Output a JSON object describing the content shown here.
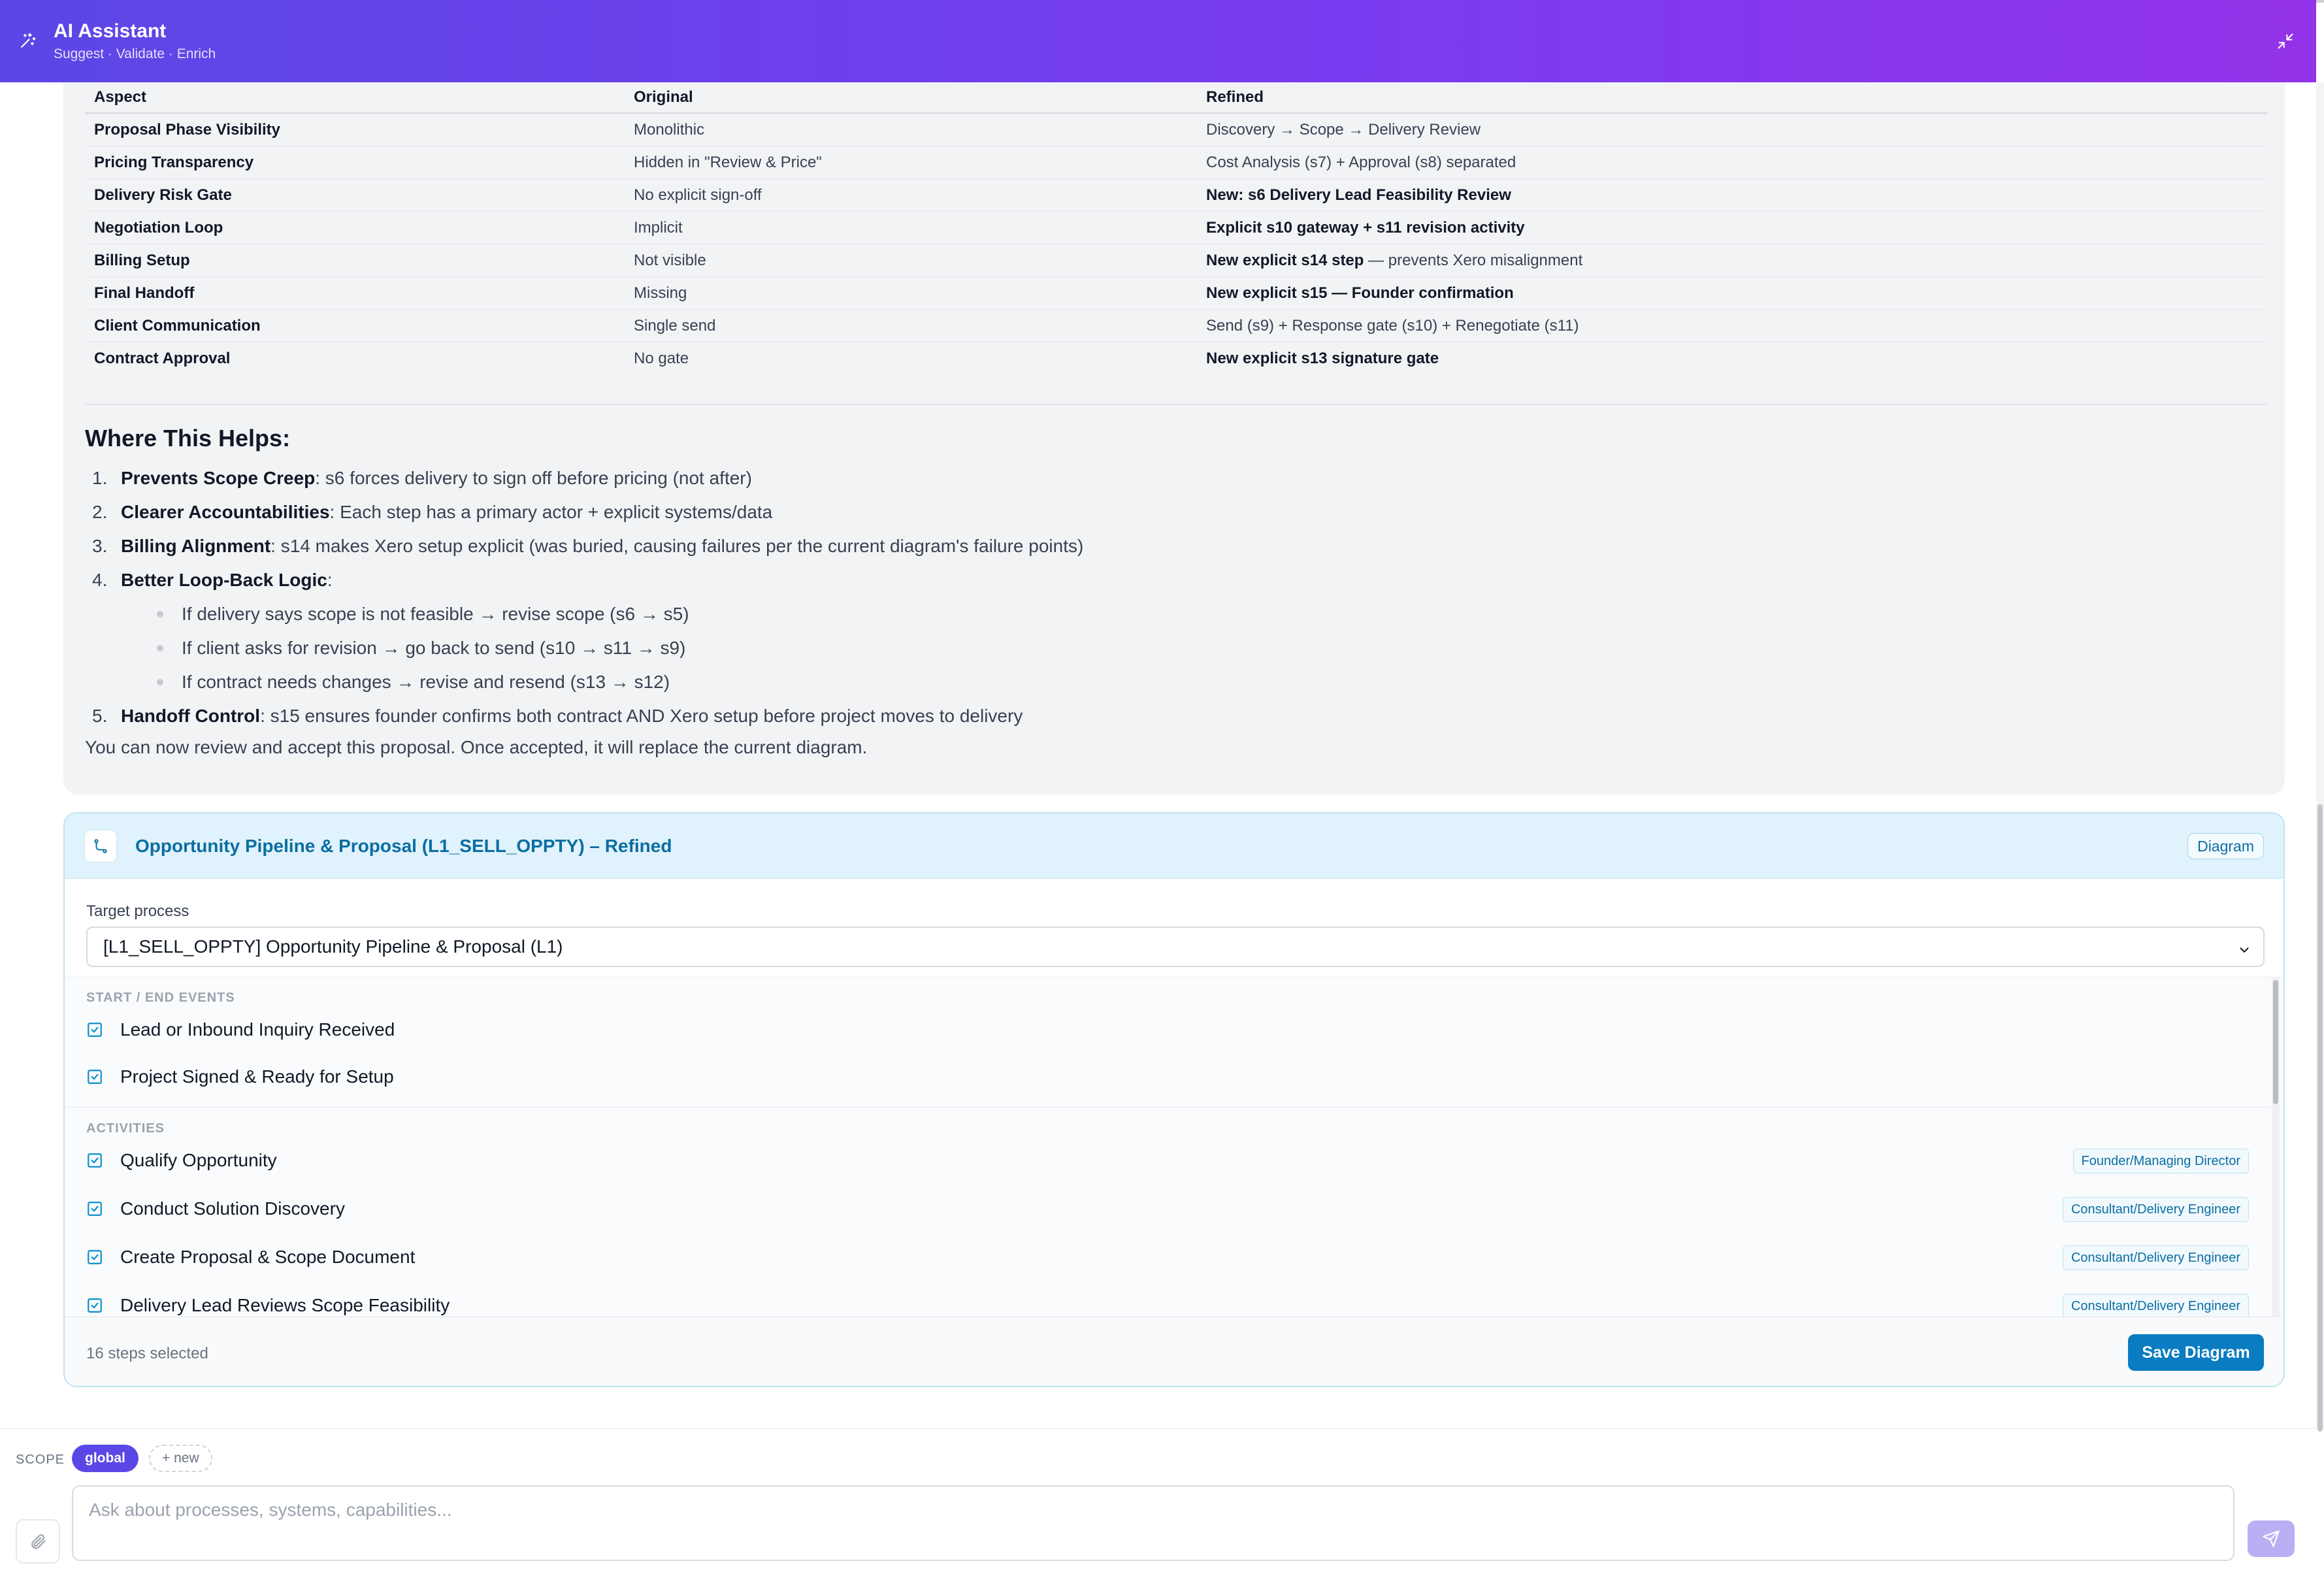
{
  "header": {
    "title": "AI Assistant",
    "subtitle": "Suggest · Validate · Enrich",
    "collapse_icon": "collapse-icon",
    "logo_icon": "sparkles-icon",
    "gradient": [
      "#5b47e6",
      "#9333ea"
    ]
  },
  "comparison": {
    "headers": [
      "Aspect",
      "Original",
      "Refined"
    ],
    "rows": [
      {
        "aspect": "Proposal Phase Visibility",
        "original": "Monolithic",
        "refined_bold": "",
        "refined": "Discovery → Scope → Delivery Review"
      },
      {
        "aspect": "Pricing Transparency",
        "original": "Hidden in \"Review & Price\"",
        "refined_bold": "",
        "refined": "Cost Analysis (s7) + Approval (s8) separated"
      },
      {
        "aspect": "Delivery Risk Gate",
        "original": "No explicit sign-off",
        "refined_bold": "New: s6 Delivery Lead Feasibility Review",
        "refined": ""
      },
      {
        "aspect": "Negotiation Loop",
        "original": "Implicit",
        "refined_bold": "Explicit s10 gateway + s11 revision activity",
        "refined": ""
      },
      {
        "aspect": "Billing Setup",
        "original": "Not visible",
        "refined_bold": "New explicit s14 step",
        "refined": " — prevents Xero misalignment"
      },
      {
        "aspect": "Final Handoff",
        "original": "Missing",
        "refined_bold": "New explicit s15 — Founder confirmation",
        "refined": ""
      },
      {
        "aspect": "Client Communication",
        "original": "Single send",
        "refined_bold": "",
        "refined": "Send (s9) + Response gate (s10) + Renegotiate (s11)"
      },
      {
        "aspect": "Contract Approval",
        "original": "No gate",
        "refined_bold": "New explicit s13 signature gate",
        "refined": ""
      }
    ]
  },
  "where_helps": {
    "heading": "Where This Helps:",
    "items": [
      {
        "num": "1.",
        "title": "Prevents Scope Creep",
        "text": ": s6 forces delivery to sign off before pricing (not after)"
      },
      {
        "num": "2.",
        "title": "Clearer Accountabilities",
        "text": ": Each step has a primary actor + explicit systems/data"
      },
      {
        "num": "3.",
        "title": "Billing Alignment",
        "text": ": s14 makes Xero setup explicit (was buried, causing failures per the current diagram's failure points)"
      },
      {
        "num": "4.",
        "title": "Better Loop-Back Logic",
        "text": ":"
      }
    ],
    "subitems": [
      "If delivery says scope is not feasible → revise scope (s6 → s5)",
      "If client asks for revision → go back to send (s10 → s11 → s9)",
      "If contract needs changes → revise and resend (s13 → s12)"
    ],
    "item5": {
      "num": "5.",
      "title": "Handoff Control",
      "text": ": s15 ensures founder confirms both contract AND Xero setup before project moves to delivery"
    },
    "closing": "You can now review and accept this proposal. Once accepted, it will replace the current diagram."
  },
  "diagram_card": {
    "icon": "diagram-icon",
    "title": "Opportunity Pipeline & Proposal (L1_SELL_OPPTY) – Refined",
    "tag": "Diagram",
    "target_label": "Target process",
    "target_value": "[L1_SELL_OPPTY] Opportunity Pipeline & Proposal (L1)",
    "sections": {
      "events_label": "START / END EVENTS",
      "events": [
        "Lead or Inbound Inquiry Received",
        "Project Signed & Ready for Setup"
      ],
      "activities_label": "ACTIVITIES",
      "activities": [
        {
          "name": "Qualify Opportunity",
          "role": "Founder/Managing Director"
        },
        {
          "name": "Conduct Solution Discovery",
          "role": "Consultant/Delivery Engineer"
        },
        {
          "name": "Create Proposal & Scope Document",
          "role": "Consultant/Delivery Engineer"
        },
        {
          "name": "Delivery Lead Reviews Scope Feasibility",
          "role": "Consultant/Delivery Engineer"
        }
      ]
    },
    "selected_count": "16 steps selected",
    "save_label": "Save Diagram",
    "accent": "#0a7cc1"
  },
  "composer": {
    "scope_label": "SCOPE",
    "scope_chip": "global",
    "new_chip": "+ new",
    "placeholder": "Ask about processes, systems, capabilities...",
    "attach_icon": "paperclip-icon",
    "send_icon": "send-icon"
  }
}
